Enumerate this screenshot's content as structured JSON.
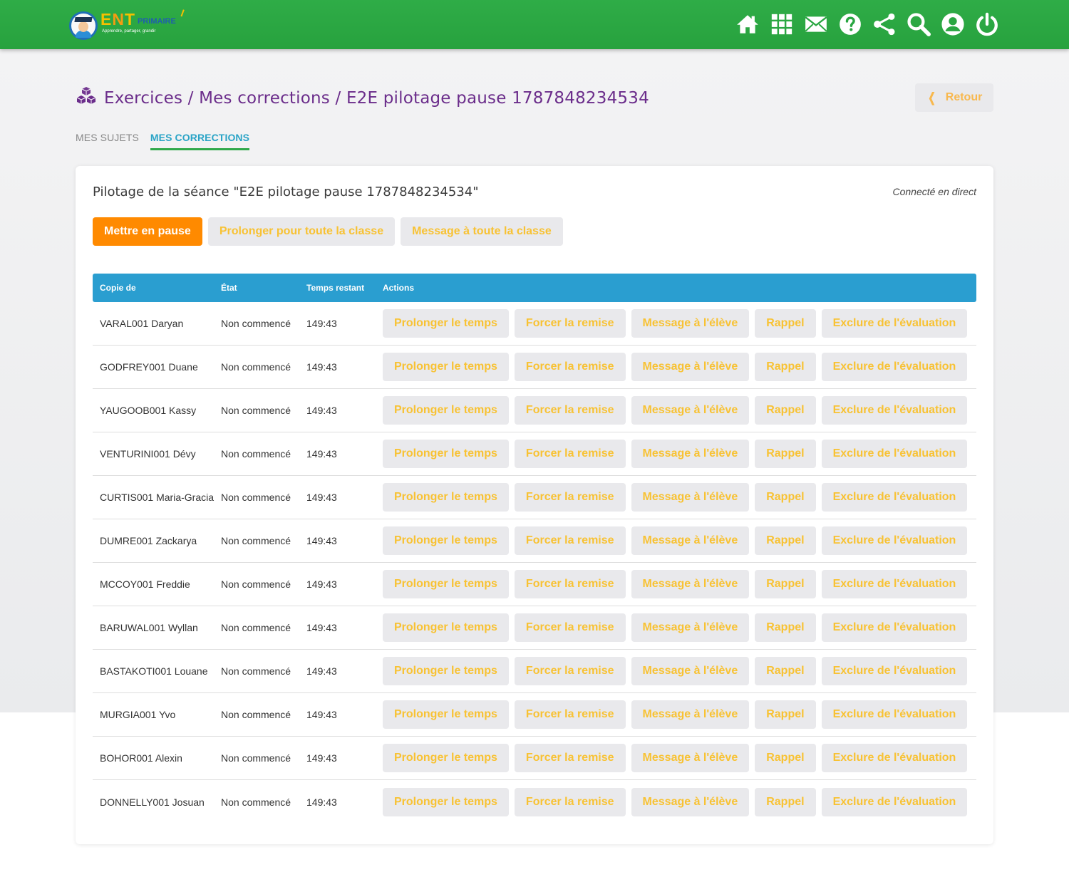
{
  "app": {
    "logo_main": "ENT",
    "logo_sub": "PRIMAIRE",
    "logo_tagline": "Apprendre, partager, grandir",
    "top_icons": [
      "home-icon",
      "apps-grid-icon",
      "mail-icon",
      "help-icon",
      "share-icon",
      "search-icon",
      "user-icon",
      "power-icon"
    ]
  },
  "breadcrumb": {
    "text": "Exercices / Mes corrections / E2E pilotage pause 1787848234534",
    "icon": "cubes-icon",
    "retour_label": "Retour"
  },
  "tabs": [
    {
      "label": "MES SUJETS",
      "active": false
    },
    {
      "label": "MES CORRECTIONS",
      "active": true
    }
  ],
  "card": {
    "title": "Pilotage de la séance \"E2E pilotage pause 1787848234534\"",
    "status": "Connecté en direct",
    "buttons": {
      "pause": "Mettre en pause",
      "extend_all": "Prolonger pour toute la classe",
      "message_all": "Message à toute la classe"
    }
  },
  "table": {
    "headers": {
      "name": "Copie de",
      "state": "État",
      "time": "Temps restant",
      "actions": "Actions"
    },
    "row_actions": [
      "Prolonger le temps",
      "Forcer la remise",
      "Message à l'élève",
      "Rappel",
      "Exclure de l'évaluation"
    ],
    "rows": [
      {
        "name": "VARAL001 Daryan",
        "state": "Non commencé",
        "time": "149:43"
      },
      {
        "name": "GODFREY001 Duane",
        "state": "Non commencé",
        "time": "149:43"
      },
      {
        "name": "YAUGOOB001 Kassy",
        "state": "Non commencé",
        "time": "149:43"
      },
      {
        "name": "VENTURINI001 Dévy",
        "state": "Non commencé",
        "time": "149:43"
      },
      {
        "name": "CURTIS001 Maria-Gracia",
        "state": "Non commencé",
        "time": "149:43"
      },
      {
        "name": "DUMRE001 Zackarya",
        "state": "Non commencé",
        "time": "149:43"
      },
      {
        "name": "MCCOY001 Freddie",
        "state": "Non commencé",
        "time": "149:43"
      },
      {
        "name": "BARUWAL001 Wyllan",
        "state": "Non commencé",
        "time": "149:43"
      },
      {
        "name": "BASTAKOTI001 Louane",
        "state": "Non commencé",
        "time": "149:43"
      },
      {
        "name": "MURGIA001 Yvo",
        "state": "Non commencé",
        "time": "149:43"
      },
      {
        "name": "BOHOR001 Alexin",
        "state": "Non commencé",
        "time": "149:43"
      },
      {
        "name": "DONNELLY001 Josuan",
        "state": "Non commencé",
        "time": "149:43"
      }
    ]
  },
  "colors": {
    "topbar": "#2fac47",
    "title_purple": "#6b2d8b",
    "table_header": "#2a9ed0",
    "pause_orange": "#ff8a00",
    "disabled_label": "#f8c233",
    "tab_active": "#2aa4c6"
  }
}
